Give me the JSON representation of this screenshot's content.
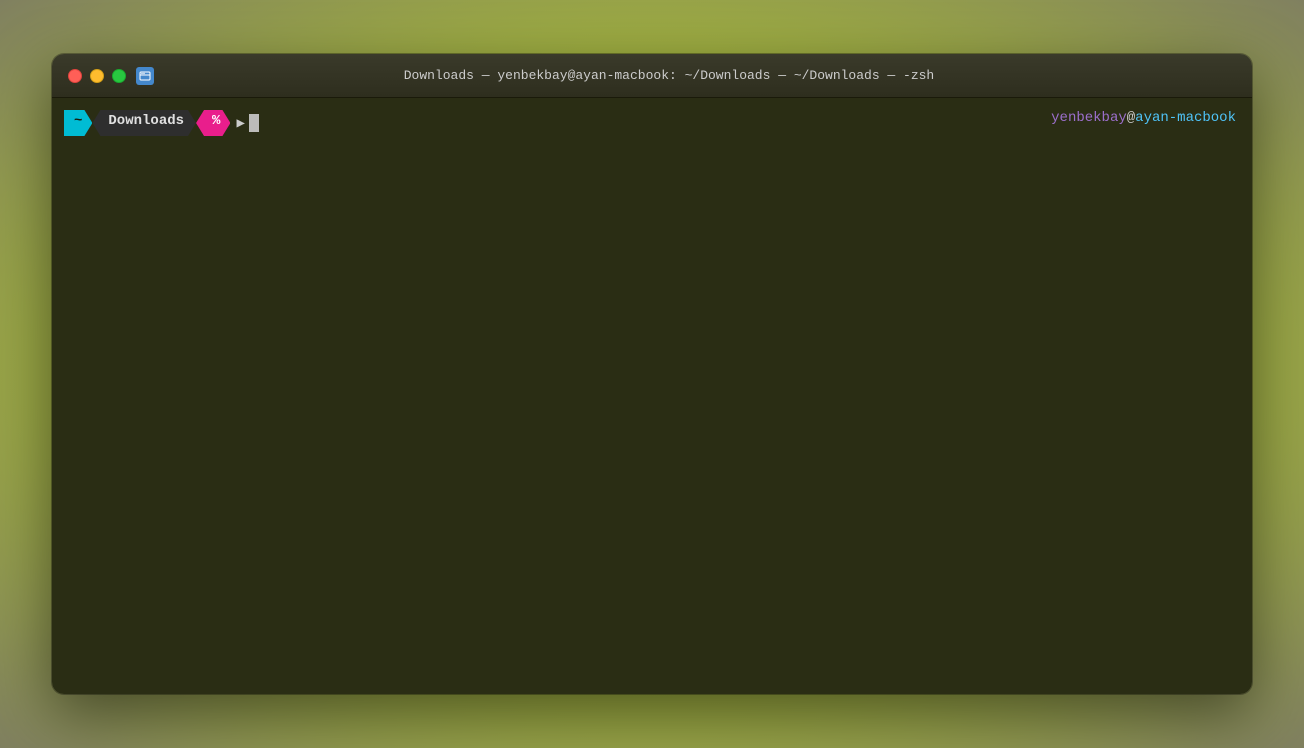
{
  "window": {
    "title": "Downloads — yenbekbay@ayan-macbook: ~/Downloads — ~/Downloads — -zsh",
    "traffic_lights": {
      "close_label": "close",
      "minimize_label": "minimize",
      "maximize_label": "maximize"
    }
  },
  "terminal": {
    "prompt": {
      "tilde": "~",
      "directory": "Downloads",
      "percent": "%",
      "cursor": ""
    },
    "user": {
      "username": "yenbekbay",
      "at": "@",
      "hostname": "ayan-macbook"
    }
  },
  "colors": {
    "background": "#2a2d14",
    "titlebar": "#2e2e1e",
    "tilde_bg": "#00bcd4",
    "percent_bg": "#e91e8c",
    "username_color": "#9c6fcc",
    "hostname_color": "#4fc3f7"
  }
}
